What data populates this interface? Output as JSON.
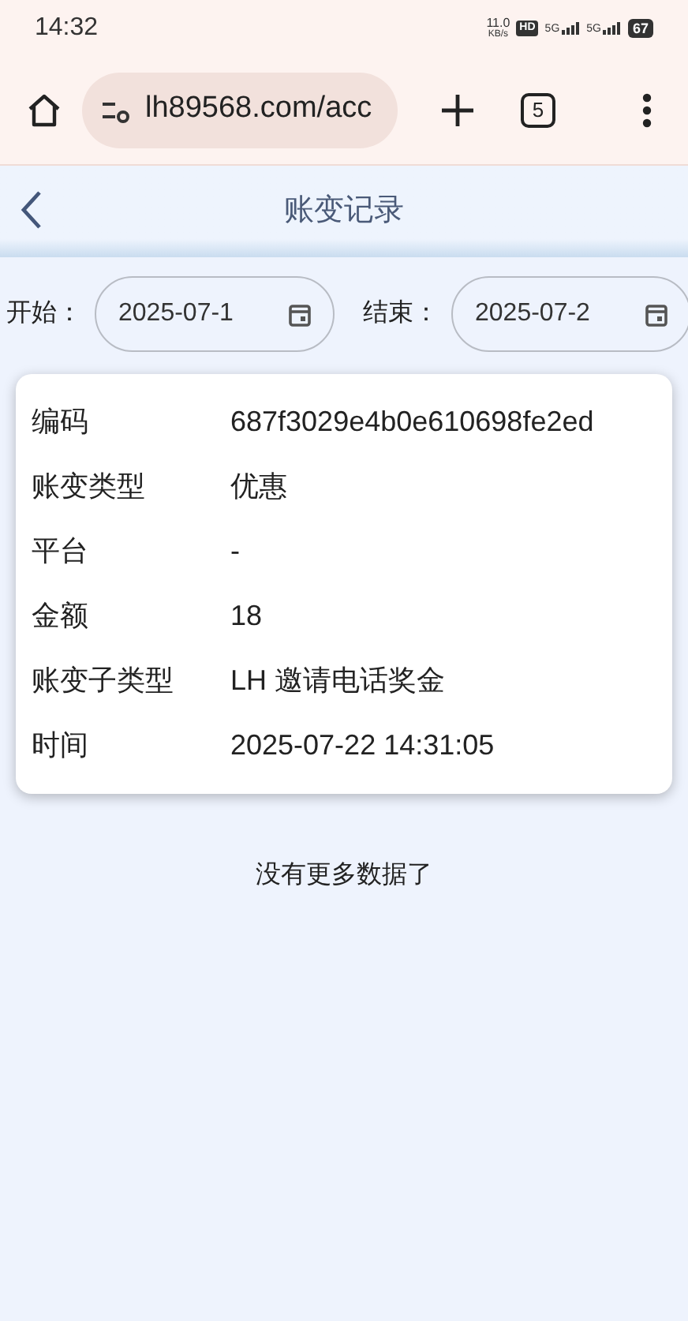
{
  "status_bar": {
    "time": "14:32",
    "net_speed": "11.0",
    "net_unit": "KB/s",
    "hd": "HD",
    "sims": [
      "5G",
      "5G"
    ],
    "battery": "67"
  },
  "browser": {
    "url": "lh89568.com/acc",
    "tab_count": "5"
  },
  "header": {
    "title": "账变记录"
  },
  "filters": [
    {
      "label": "开始：",
      "value": "2025-07-1"
    },
    {
      "label": "结束：",
      "value": "2025-07-2"
    }
  ],
  "record": [
    {
      "label": "编码",
      "value": "687f3029e4b0e610698fe2ed"
    },
    {
      "label": "账变类型",
      "value": "优惠"
    },
    {
      "label": "平台",
      "value": "-"
    },
    {
      "label": "金额",
      "value": "18"
    },
    {
      "label": "账变子类型",
      "value": "LH 邀请电话奖金"
    },
    {
      "label": "时间",
      "value": "2025-07-22 14:31:05"
    }
  ],
  "footer_note": "没有更多数据了"
}
